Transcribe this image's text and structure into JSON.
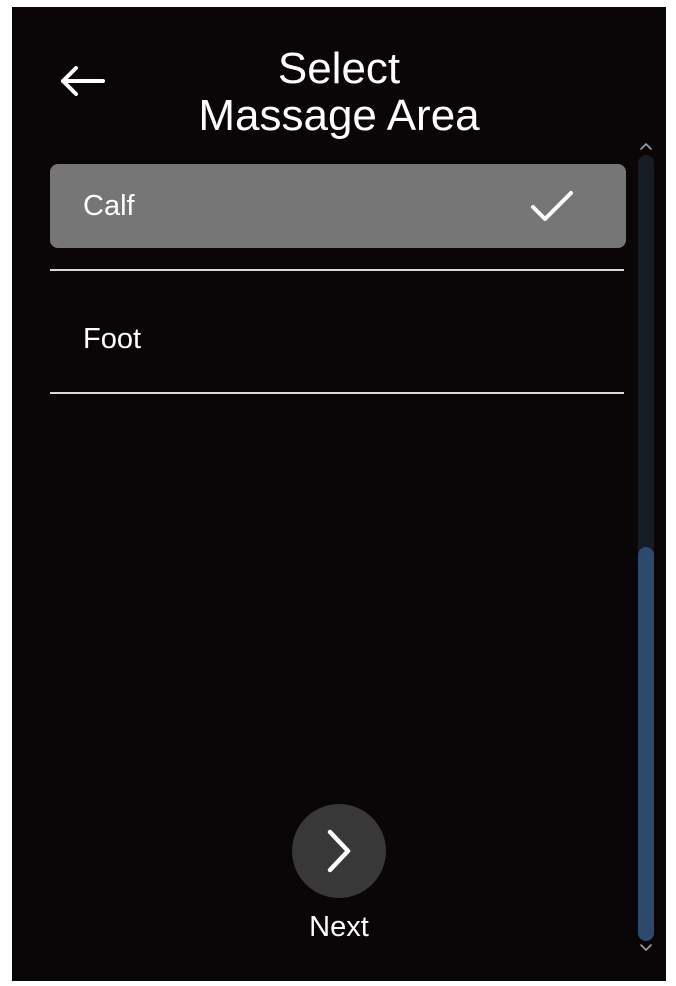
{
  "header": {
    "title_line1": "Select",
    "title_line2": "Massage Area",
    "back_icon": "arrow-left-icon"
  },
  "areas": [
    {
      "label": "Calf",
      "selected": true
    },
    {
      "label": "Foot",
      "selected": false
    }
  ],
  "selection_icon": "checkmark-icon",
  "next": {
    "label": "Next",
    "icon": "chevron-right-icon"
  },
  "colors": {
    "background": "#0a0506",
    "selected_row": "#767676",
    "text": "#ffffff",
    "scroll_thumb": "#2c4a6e",
    "next_button": "#383838"
  }
}
